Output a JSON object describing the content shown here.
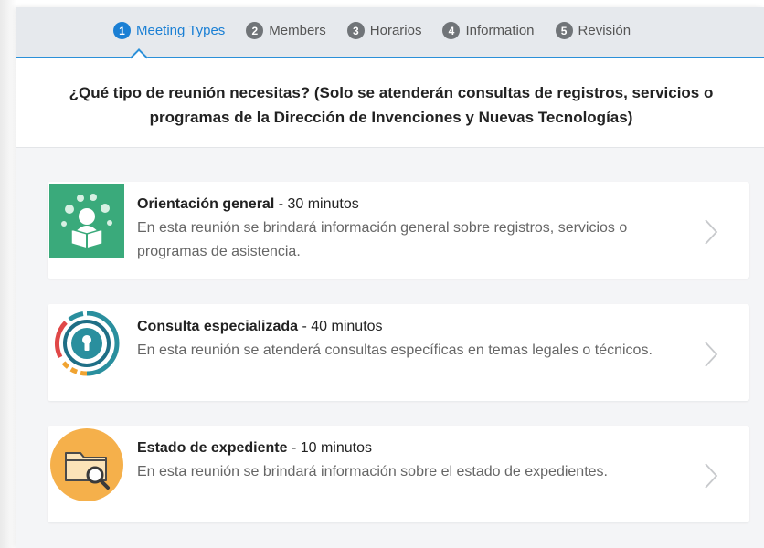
{
  "steps": [
    {
      "num": "1",
      "label": "Meeting Types"
    },
    {
      "num": "2",
      "label": "Members"
    },
    {
      "num": "3",
      "label": "Horarios"
    },
    {
      "num": "4",
      "label": "Information"
    },
    {
      "num": "5",
      "label": "Revisión"
    }
  ],
  "active_step": 1,
  "question": "¿Qué tipo de reunión necesitas? (Solo se atenderán consultas de registros, servicios o programas de la Dirección de Invenciones y Nuevas Tecnologías)",
  "meetings": [
    {
      "title": "Orientación general",
      "duration": " - 30 minutos",
      "description": "En esta reunión se brindará información general sobre registros, servicios o programas de asistencia.",
      "icon": "reading-person-icon"
    },
    {
      "title": "Consulta especializada",
      "duration": " - 40 minutos",
      "description": "En esta reunión se atenderá consultas específicas en temas legales o técnicos.",
      "icon": "keyhole-circle-icon"
    },
    {
      "title": "Estado de expediente",
      "duration": " - 10 minutos",
      "description": "En esta reunión se brindará información sobre el estado de expedientes.",
      "icon": "folder-search-icon"
    }
  ],
  "colors": {
    "accent": "#1a7fd4",
    "green_tile": "#3aaa7b",
    "orange_circle": "#f5b04b"
  }
}
